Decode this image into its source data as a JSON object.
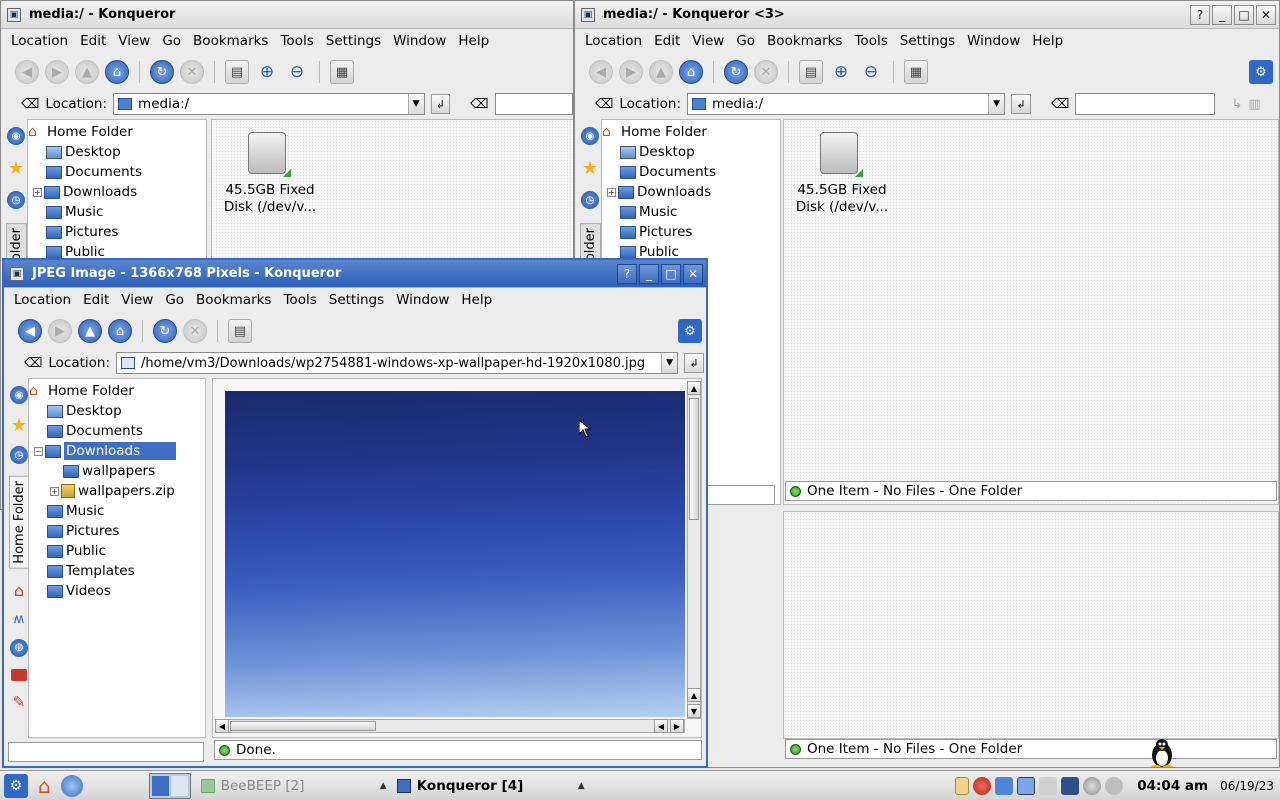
{
  "window_left": {
    "title": "media:/ - Konqueror",
    "location_label": "Location:",
    "location_value": "media:/",
    "disk_label_line1": "45.5GB Fixed",
    "disk_label_line2": "Disk (/dev/v..."
  },
  "window_right": {
    "title": "media:/ - Konqueror <3>",
    "location_label": "Location:",
    "location_value": "media:/",
    "disk_label_line1": "45.5GB Fixed",
    "disk_label_line2": "Disk (/dev/v...",
    "status_top": "One Item - No Files - One Folder",
    "status_bottom": "One Item - No Files - One Folder"
  },
  "window_jpeg": {
    "title": "JPEG Image - 1366x768 Pixels - Konqueror",
    "location_label": "Location:",
    "location_value": "/home/vm3/Downloads/wp2754881-windows-xp-wallpaper-hd-1920x1080.jpg",
    "status": "Done.",
    "sidebar_tab": "Home Folder"
  },
  "menu": [
    "Location",
    "Edit",
    "View",
    "Go",
    "Bookmarks",
    "Tools",
    "Settings",
    "Window",
    "Help"
  ],
  "tree_top": [
    "Home Folder",
    "Desktop",
    "Documents",
    "Downloads",
    "Music",
    "Pictures",
    "Public"
  ],
  "tree_jpeg": {
    "home": "Home Folder",
    "desktop": "Desktop",
    "documents": "Documents",
    "downloads": "Downloads",
    "wallpapers": "wallpapers",
    "wallpapers_zip": "wallpapers.zip",
    "music": "Music",
    "pictures": "Pictures",
    "public": "Public",
    "templates": "Templates",
    "videos": "Videos"
  },
  "sidebar_tab_partial": "older",
  "taskbar": {
    "beebeep": "BeeBEEP [2]",
    "konqueror": "Konqueror [4]",
    "time": "04:04 am",
    "date": "06/19/23"
  },
  "icons": {
    "back": "back-arrow-icon",
    "forward": "forward-arrow-icon",
    "up": "up-arrow-icon",
    "home": "home-icon",
    "reload": "reload-icon",
    "stop": "stop-icon",
    "print": "print-icon",
    "zoom_in": "zoom-in-icon",
    "zoom_out": "zoom-out-icon",
    "view_mode": "view-mode-icon"
  },
  "colors": {
    "active_title": "#2d5fb6",
    "selection": "#3f6fc4",
    "folder": "#3467bb",
    "status_led": "#2a8d1c"
  }
}
